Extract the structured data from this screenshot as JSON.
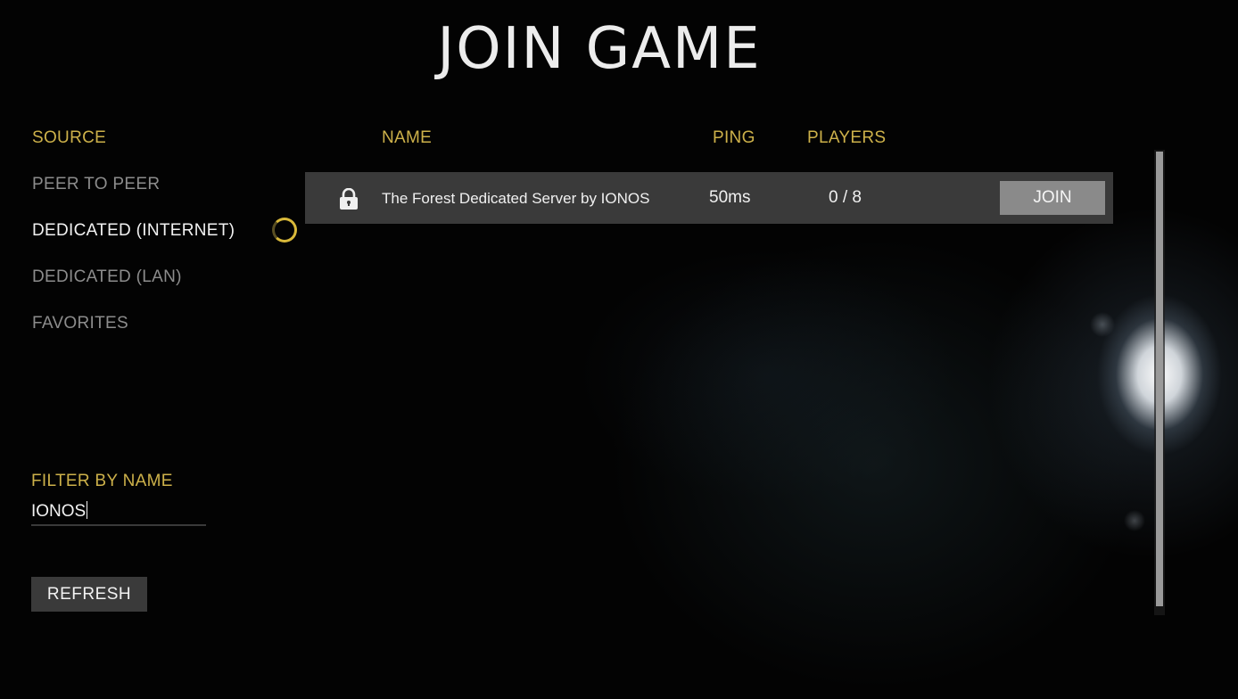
{
  "title": "JOIN GAME",
  "colors": {
    "accent": "#cdb14a",
    "active_text": "#f2f2f2",
    "inactive_text": "#8c8c8c",
    "row_background": "#3a3a3a",
    "button_background": "#8a8a8a"
  },
  "sidebar": {
    "source_heading": "SOURCE",
    "items": [
      {
        "label": "PEER TO PEER"
      },
      {
        "label": "DEDICATED (INTERNET)"
      },
      {
        "label": "DEDICATED (LAN)"
      },
      {
        "label": "FAVORITES"
      }
    ],
    "selected": "DEDICATED (INTERNET)",
    "loading_icon": "spinner-icon"
  },
  "table": {
    "columns": {
      "name": "NAME",
      "ping": "PING",
      "players": "PLAYERS"
    },
    "rows": [
      {
        "icon": "lock-icon",
        "name": "The Forest Dedicated Server by IONOS",
        "ping": "50ms",
        "players": "0 / 8",
        "join_label": "JOIN"
      }
    ]
  },
  "filter": {
    "heading": "FILTER BY NAME",
    "value": "IONOS"
  },
  "refresh_label": "REFRESH"
}
